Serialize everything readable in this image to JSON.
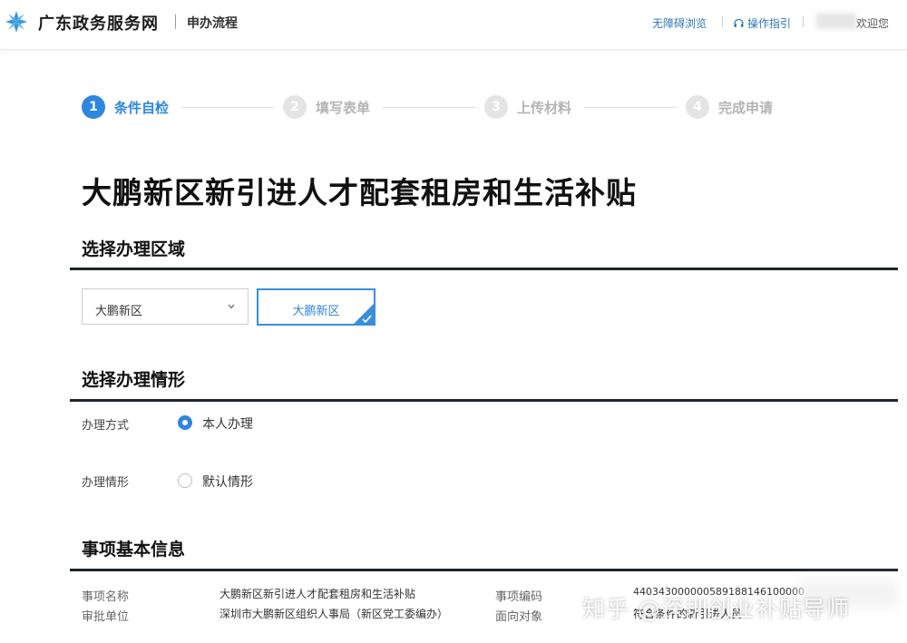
{
  "header": {
    "brand": "广东政务服务网",
    "flow_name": "申办流程",
    "accessible_link": "无障碍浏览",
    "guide_link": "操作指引",
    "welcome": "欢迎您"
  },
  "steps": [
    {
      "num": "1",
      "label": "条件自检",
      "active": true
    },
    {
      "num": "2",
      "label": "填写表单",
      "active": false
    },
    {
      "num": "3",
      "label": "上传材料",
      "active": false
    },
    {
      "num": "4",
      "label": "完成申请",
      "active": false
    }
  ],
  "page_title": "大鹏新区新引进人才配套租房和生活补贴",
  "region": {
    "section_title": "选择办理区域",
    "select_value": "大鹏新区",
    "selected_option": "大鹏新区"
  },
  "situation": {
    "section_title": "选择办理情形",
    "method_label": "办理方式",
    "method_option": "本人办理",
    "case_label": "办理情形",
    "case_option": "默认情形"
  },
  "basic_info": {
    "section_title": "事项基本信息",
    "name_key": "事项名称",
    "name_value": "大鹏新区新引进人才配套租房和生活补贴",
    "dept_key": "审批单位",
    "dept_value": "深圳市大鹏新区组织人事局（新区党工委编办）",
    "code_key": "事项编码",
    "code_value": "440343000000589188146100000",
    "target_key": "面向对象",
    "target_value": "符合条件的新引进人员"
  },
  "watermark": "知乎 @深圳创业补贴导师",
  "colors": {
    "accent": "#2e86de",
    "rule": "#1d2530"
  }
}
